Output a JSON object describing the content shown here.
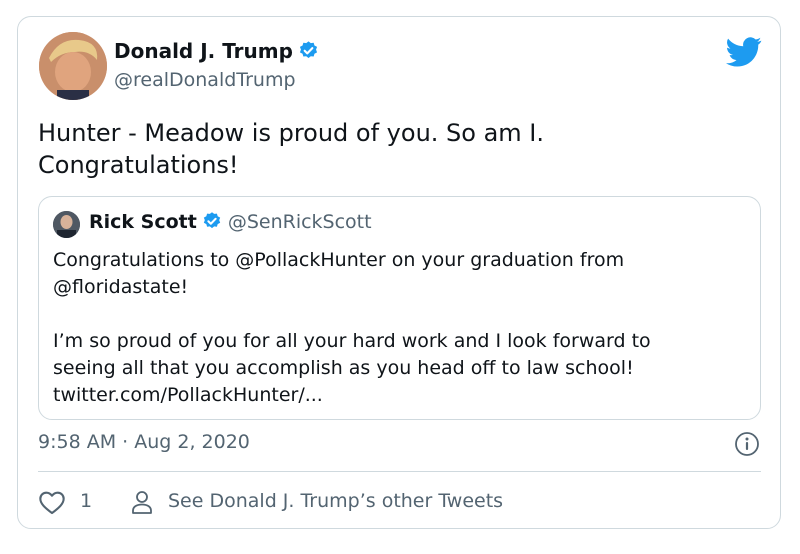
{
  "author": {
    "name": "Donald J. Trump",
    "handle": "@realDonaldTrump",
    "verified": true
  },
  "tweet": {
    "text": "Hunter - Meadow is proud of you. So am I.\nCongratulations!"
  },
  "quoted": {
    "name": "Rick Scott",
    "handle": "@SenRickScott",
    "verified": true,
    "text": "Congratulations to @PollackHunter on your graduation from\n@floridastate!\n\nI’m so proud of you for all your hard work and I look forward to\nseeing all that you accomplish as you head off to law school!\ntwitter.com/PollackHunter/..."
  },
  "meta": {
    "timestamp": "9:58 AM · Aug 2, 2020"
  },
  "actions": {
    "like_count": "1",
    "other_tweets_label": "See Donald J. Trump’s other Tweets"
  },
  "icons": {
    "brand": "twitter-bird-icon",
    "verified": "verified-badge-icon",
    "info": "info-icon",
    "like": "heart-icon",
    "profile": "person-icon"
  },
  "colors": {
    "brand": "#1d9bf0",
    "text": "#0f1419",
    "muted": "#536471",
    "border": "#cfd9de"
  }
}
